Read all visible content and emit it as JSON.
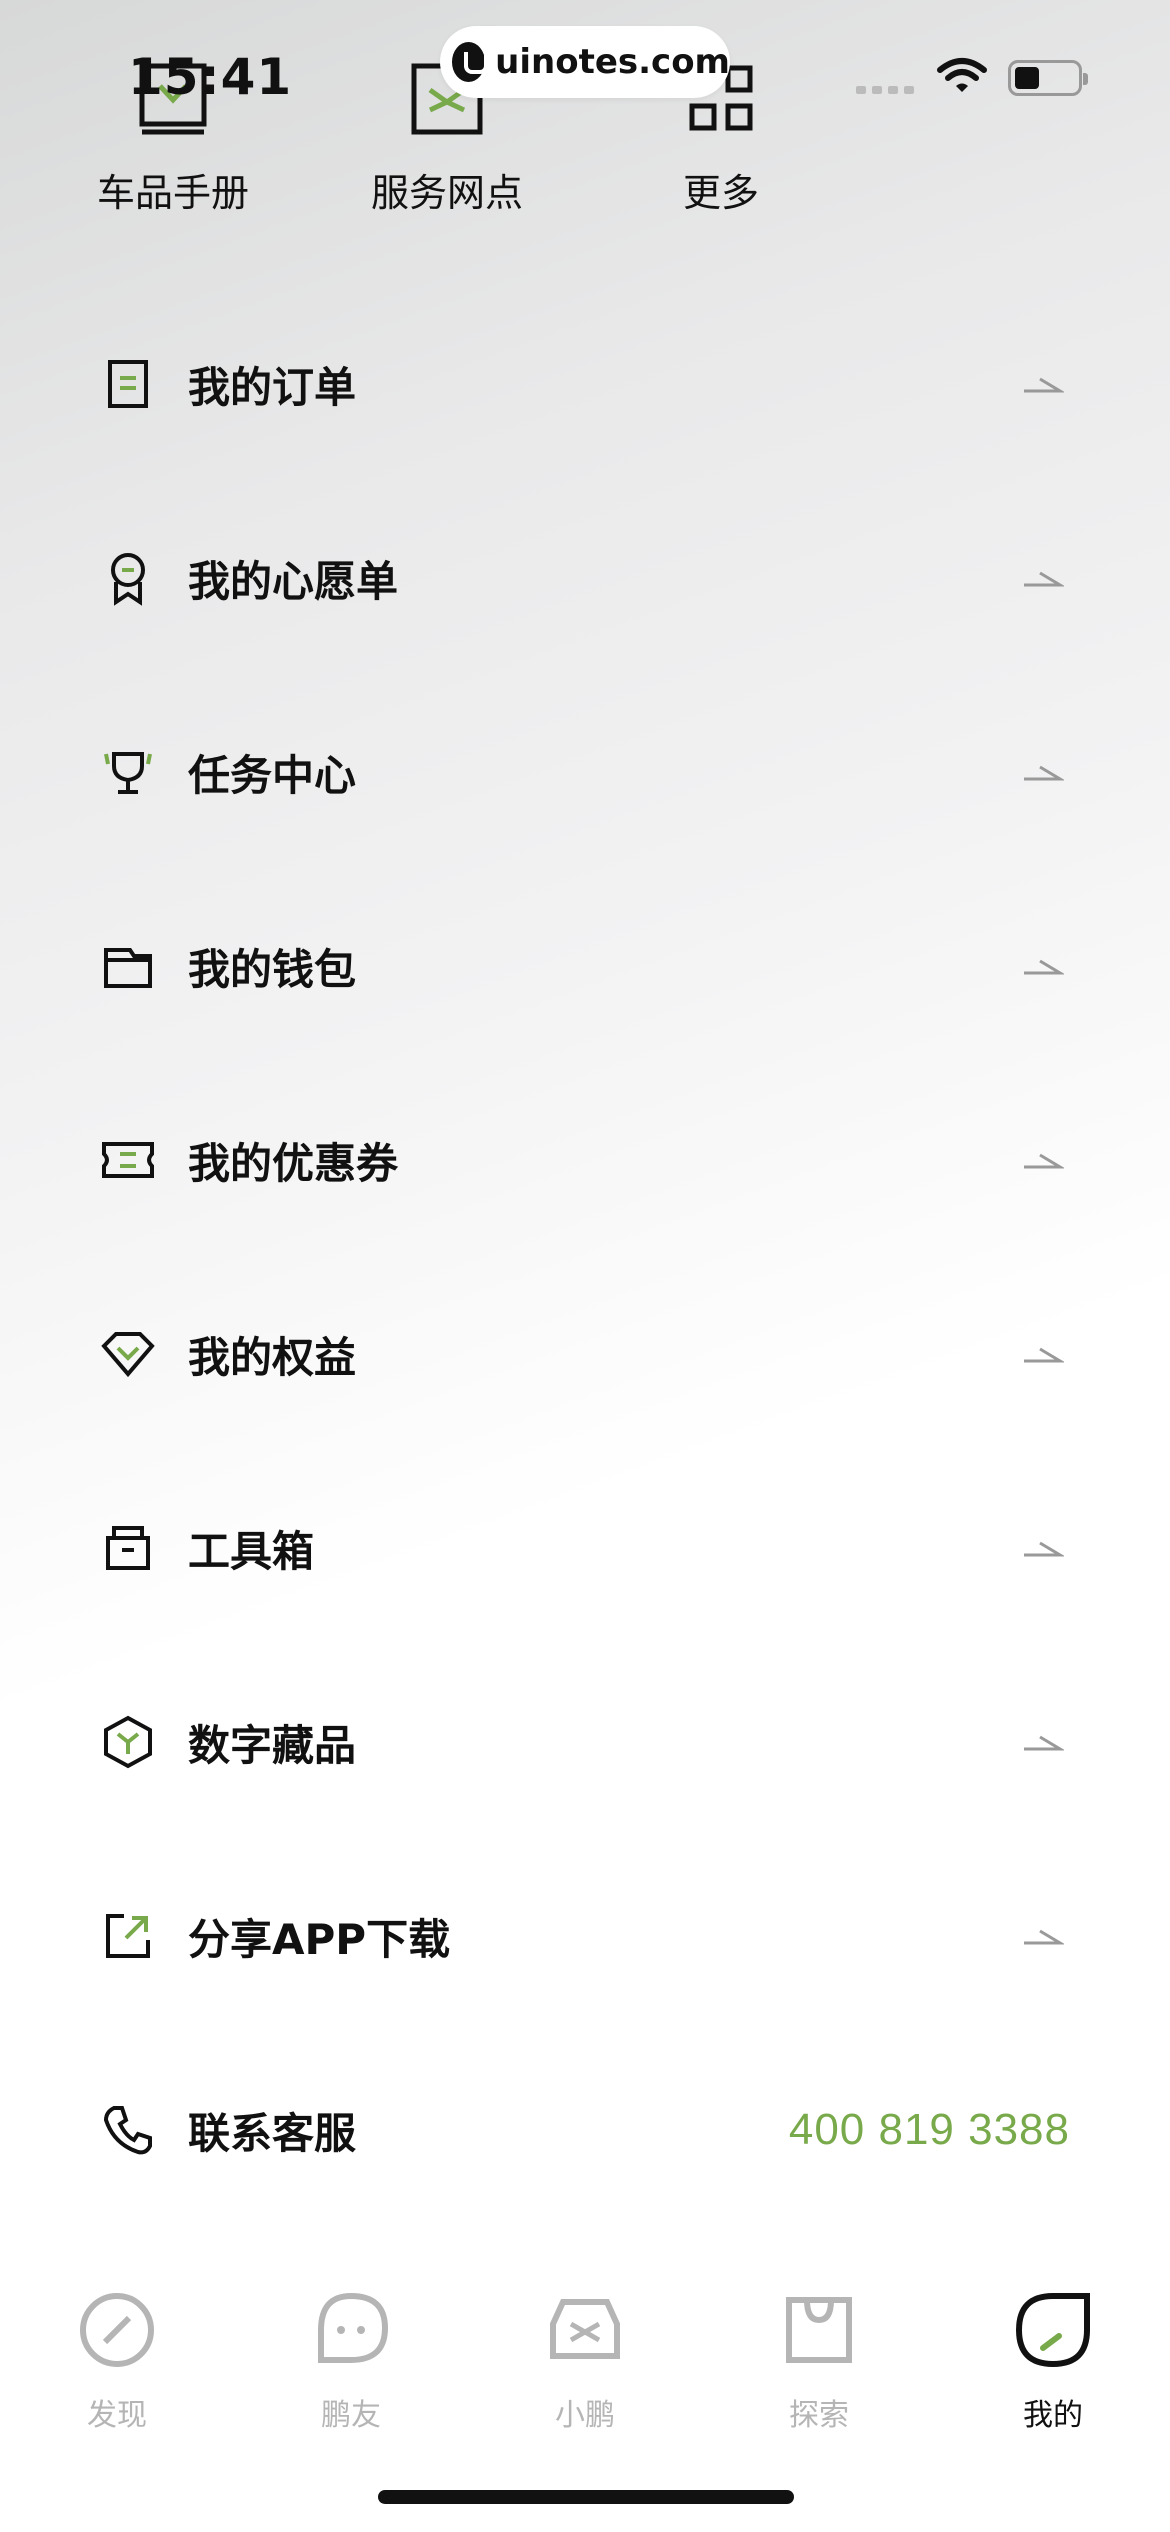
{
  "status_bar": {
    "time": "15:41",
    "watermark": "uinotes.com"
  },
  "shortcuts": [
    {
      "label": "车品手册",
      "icon": "manual-icon"
    },
    {
      "label": "服务网点",
      "icon": "service-point-icon"
    },
    {
      "label": "更多",
      "icon": "more-grid-icon"
    }
  ],
  "menu": [
    {
      "label": "我的订单",
      "icon": "order-icon"
    },
    {
      "label": "我的心愿单",
      "icon": "wishlist-icon"
    },
    {
      "label": "任务中心",
      "icon": "trophy-icon"
    },
    {
      "label": "我的钱包",
      "icon": "wallet-icon"
    },
    {
      "label": "我的优惠券",
      "icon": "coupon-icon"
    },
    {
      "label": "我的权益",
      "icon": "diamond-icon"
    },
    {
      "label": "工具箱",
      "icon": "toolbox-icon"
    },
    {
      "label": "数字藏品",
      "icon": "cube-icon"
    },
    {
      "label": "分享APP下载",
      "icon": "share-icon"
    }
  ],
  "contact": {
    "label": "联系客服",
    "phone": "400 819 3388",
    "icon": "phone-icon"
  },
  "tabbar": [
    {
      "label": "发现",
      "icon": "compass-icon",
      "active": false
    },
    {
      "label": "鹏友",
      "icon": "chat-icon",
      "active": false
    },
    {
      "label": "小鹏",
      "icon": "car-icon",
      "active": false
    },
    {
      "label": "探索",
      "icon": "shopping-bag-icon",
      "active": false
    },
    {
      "label": "我的",
      "icon": "profile-leaf-icon",
      "active": true
    }
  ],
  "colors": {
    "accent_green": "#78a94a",
    "text_dark": "#111111",
    "inactive_gray": "#b5b5b5"
  }
}
